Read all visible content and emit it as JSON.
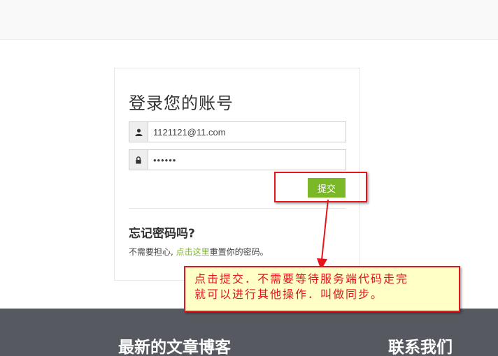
{
  "login": {
    "title": "登录您的账号",
    "email_value": "1121121@11.com",
    "password_mask": "••••••",
    "submit_label": "提交"
  },
  "forgot": {
    "title": "忘记密码吗?",
    "text_before": "不需要担心, ",
    "link_text": "点击这里",
    "text_after": "重置你的密码。"
  },
  "annotation": {
    "line1": "点击提交．不需要等待服务端代码走完",
    "line2": "就可以进行其他操作．叫做同步。"
  },
  "footer": {
    "col1_title": "最新的文章博客",
    "col2_title": "联系我们"
  },
  "colors": {
    "accent_green": "#7ab827",
    "annotation_red": "#e8141b",
    "annotation_bg": "#ffffc6",
    "footer_bg": "#565a60"
  },
  "icons": {
    "email_addon": "user-icon",
    "password_addon": "lock-icon"
  }
}
